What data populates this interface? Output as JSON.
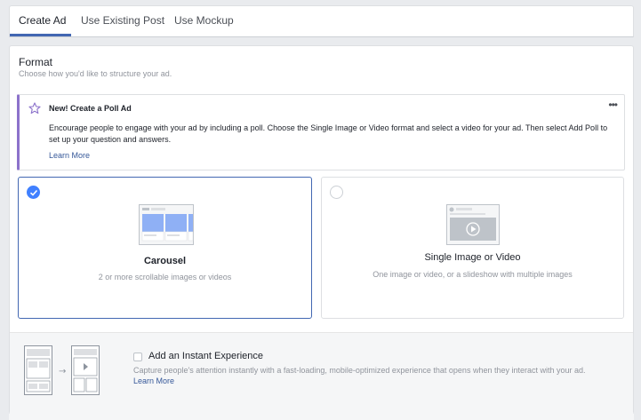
{
  "tabs": [
    {
      "label": "Create Ad",
      "active": true
    },
    {
      "label": "Use Existing Post",
      "active": false
    },
    {
      "label": "Use Mockup",
      "active": false
    }
  ],
  "format": {
    "title": "Format",
    "subtitle": "Choose how you'd like to structure your ad."
  },
  "notice": {
    "icon": "star-outline-icon",
    "title": "New! Create a Poll Ad",
    "more": "•••",
    "body": "Encourage people to engage with your ad by including a poll. Choose the Single Image or Video format and select a video for your ad. Then select Add Poll to set up your question and answers.",
    "link": "Learn More",
    "accent_color": "#8c72cb"
  },
  "options": [
    {
      "title": "Carousel",
      "description": "2 or more scrollable images or videos",
      "selected": true,
      "icon": "carousel-icon"
    },
    {
      "title": "Single Image or Video",
      "description": "One image or video, or a slideshow with multiple images",
      "selected": false,
      "icon": "single-image-video-icon"
    }
  ],
  "instant_experience": {
    "title": "Add an Instant Experience",
    "description": "Capture people's attention instantly with a fast-loading, mobile-optimized experience that opens when they interact with your ad.",
    "link": "Learn More",
    "checked": false,
    "arrow": "→"
  },
  "colors": {
    "primary": "#4267b2",
    "selected_check": "#4080ff",
    "link": "#365899",
    "muted_text": "#90949c"
  }
}
